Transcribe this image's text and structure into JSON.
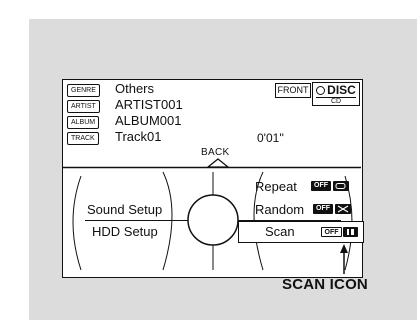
{
  "track_info": {
    "genre": {
      "tag": "GENRE",
      "value": "Others"
    },
    "artist": {
      "tag": "ARTIST",
      "value": "ARTIST001"
    },
    "album": {
      "tag": "ALBUM",
      "value": "ALBUM001"
    },
    "track": {
      "tag": "TRACK",
      "value": "Track01"
    },
    "elapsed_time": "0'01''"
  },
  "source": {
    "front_label": "FRONT",
    "disc_label": "DISC",
    "cd_label": "CD"
  },
  "back_label": "BACK",
  "menu": {
    "left_items": [
      "Sound Setup",
      "HDD Setup"
    ],
    "right_items": [
      {
        "label": "Repeat",
        "state": "OFF",
        "icon": "repeat-icon"
      },
      {
        "label": "Random",
        "state": "OFF",
        "icon": "random-icon"
      },
      {
        "label": "Scan",
        "state": "OFF",
        "icon": "scan-icon",
        "selected": true
      }
    ]
  },
  "callout": {
    "label": "SCAN ICON"
  }
}
